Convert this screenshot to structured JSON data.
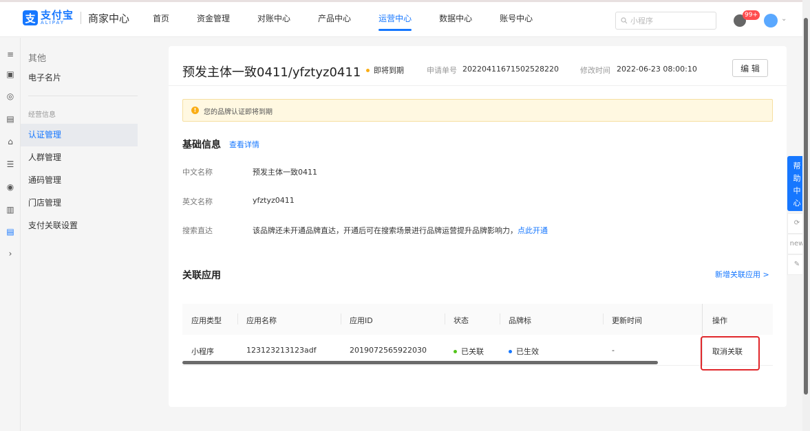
{
  "brand": {
    "mark": "支",
    "name_cn": "支付宝",
    "name_en": "ALIPAY",
    "subtitle": "商家中心"
  },
  "nav": [
    {
      "label": "首页"
    },
    {
      "label": "资金管理"
    },
    {
      "label": "对账中心"
    },
    {
      "label": "产品中心"
    },
    {
      "label": "运营中心",
      "active": true
    },
    {
      "label": "数据中心"
    },
    {
      "label": "账号中心"
    }
  ],
  "search": {
    "placeholder": "小程序"
  },
  "notifications": {
    "count": "99+"
  },
  "subnav": {
    "group_title": "其他",
    "item_top": "电子名片",
    "section_label": "经营信息",
    "items": [
      "认证管理",
      "人群管理",
      "通码管理",
      "门店管理",
      "支付关联设置"
    ]
  },
  "header": {
    "title": "预发主体一致0411/yfztyz0411",
    "status": "即将到期",
    "status_color": "#faad14",
    "apply_no_label": "申请单号",
    "apply_no": "20220411671502528220",
    "modified_label": "修改时间",
    "modified_time": "2022-06-23 08:00:10",
    "edit_label": "编 辑"
  },
  "warning": {
    "text": "您的品牌认证即将到期",
    "icon": "!"
  },
  "basic": {
    "title": "基础信息",
    "detail_link": "查看详情",
    "cn_name_label": "中文名称",
    "cn_name": "预发主体一致0411",
    "en_name_label": "英文名称",
    "en_name": "yfztyz0411",
    "search_label": "搜索直达",
    "search_desc": "该品牌还未开通品牌直达，开通后可在搜索场景进行品牌运营提升品牌影响力，",
    "search_link": "点此开通"
  },
  "apps": {
    "title": "关联应用",
    "add_link": "新增关联应用 >",
    "columns": [
      "应用类型",
      "应用名称",
      "应用ID",
      "状态",
      "品牌标",
      "更新时间",
      "操作"
    ],
    "rows": [
      {
        "type": "小程序",
        "name": "123123213123adf",
        "id": "2019072565922030",
        "status": "已关联",
        "status_color": "#52c41a",
        "brand": "已生效",
        "brand_color": "#1677ff",
        "updated": "-",
        "action": "取消关联"
      }
    ]
  },
  "help": {
    "label": "帮助中心",
    "tools": [
      "⟳",
      "new",
      "✎"
    ]
  },
  "accent": "#1677ff"
}
